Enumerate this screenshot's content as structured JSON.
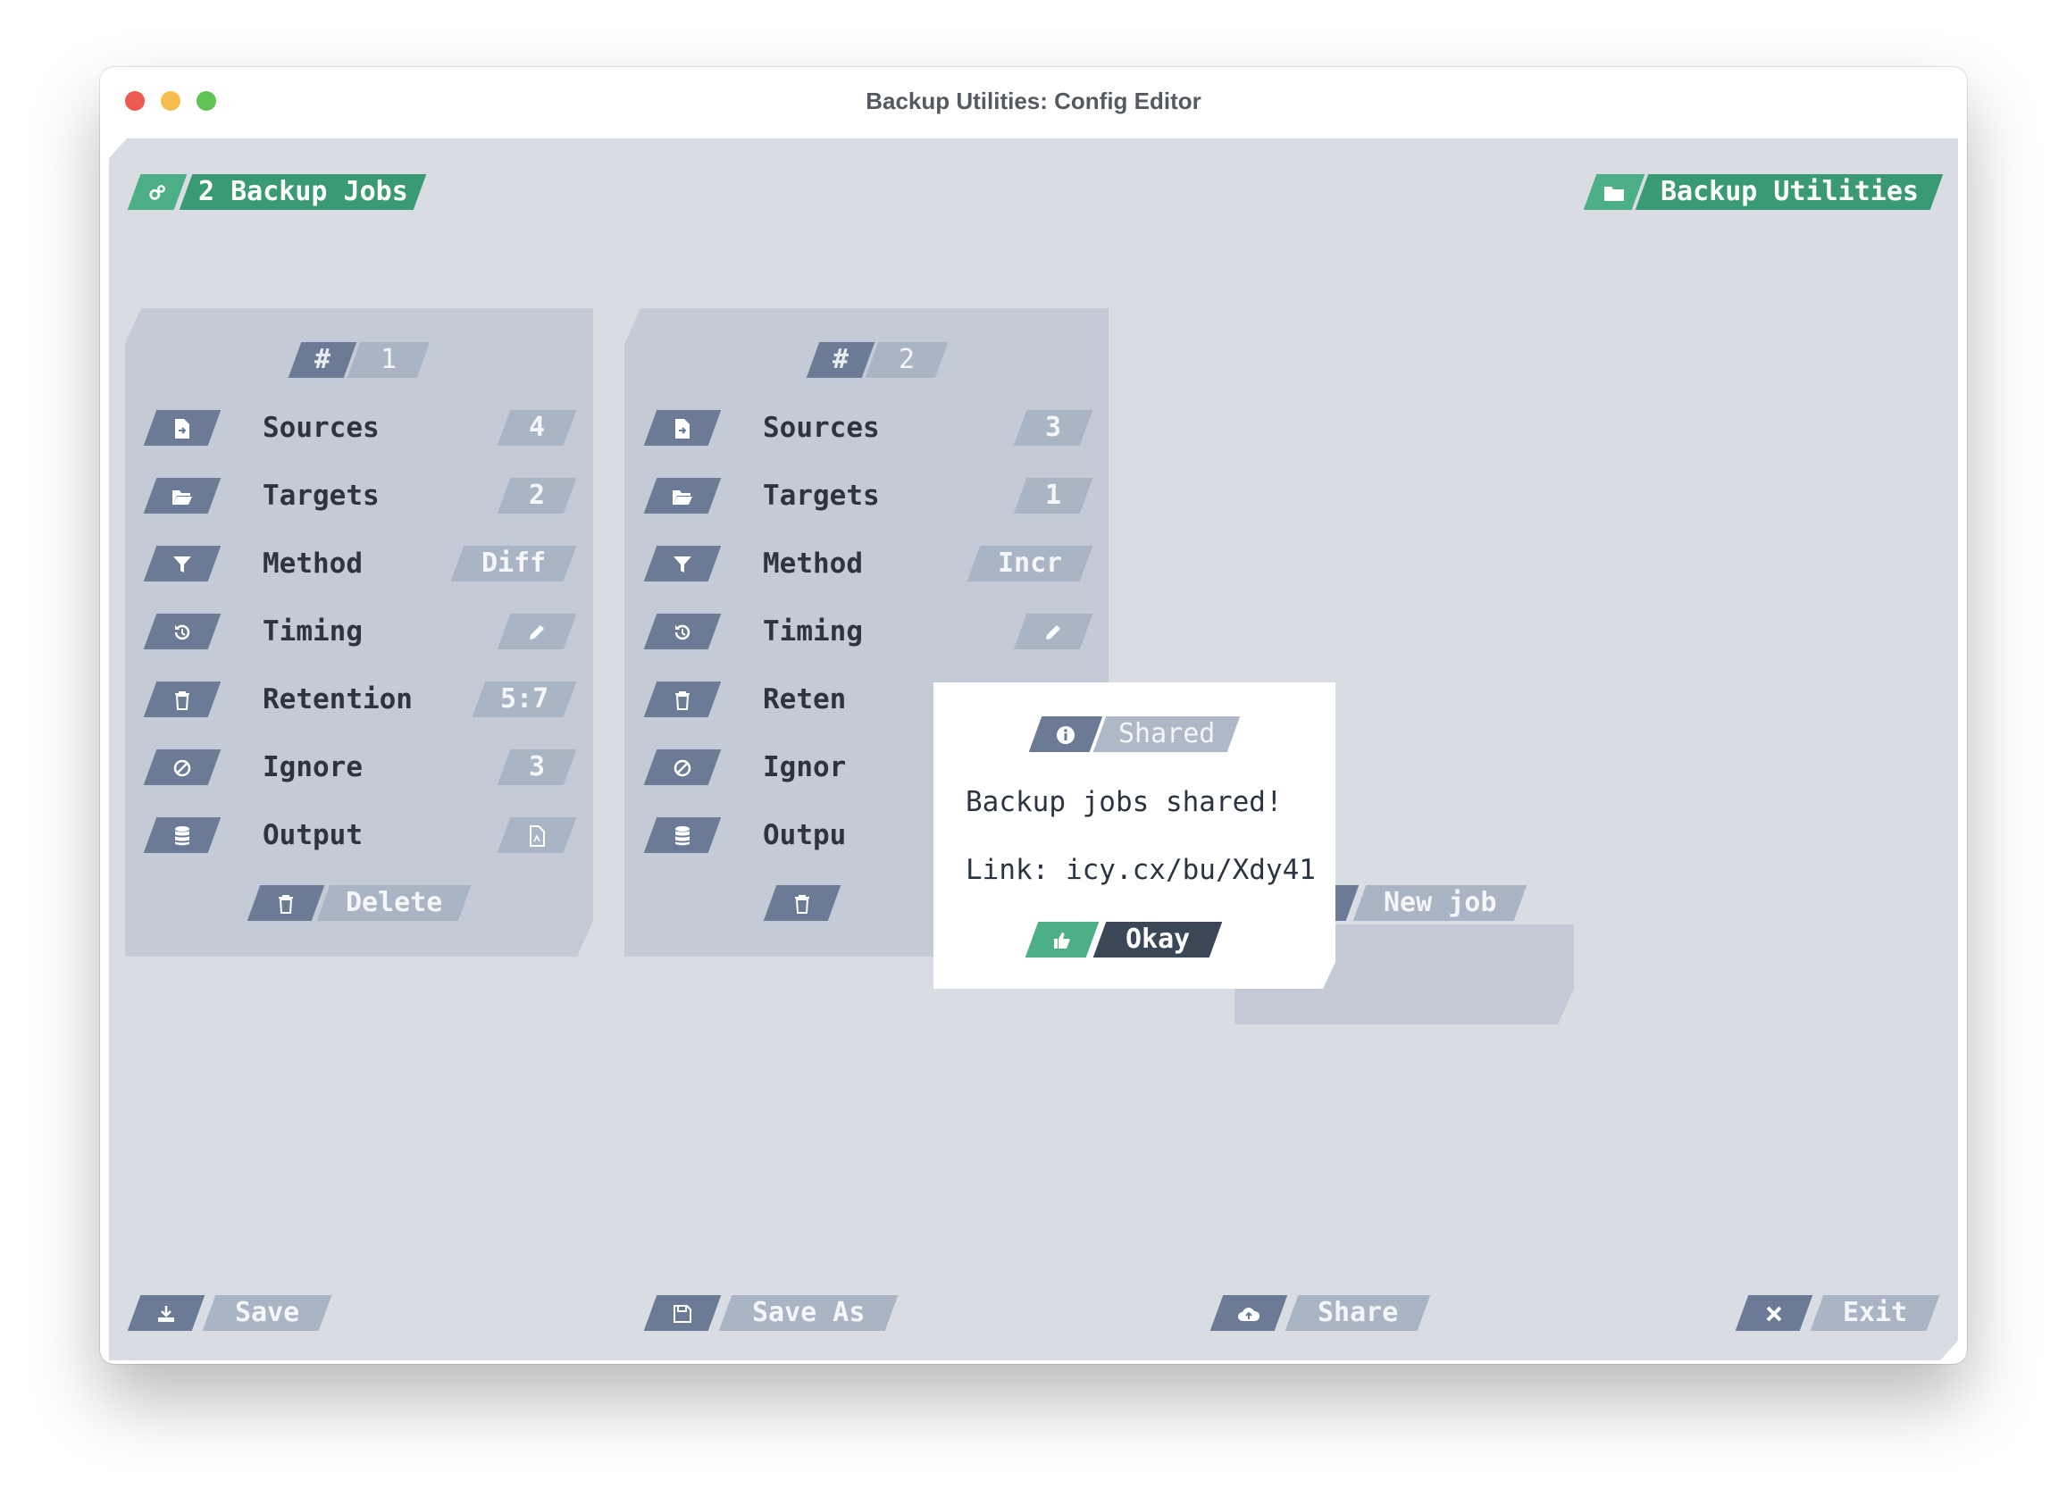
{
  "window": {
    "title": "Backup Utilities: Config Editor"
  },
  "header": {
    "jobs_count_label": "2 Backup Jobs",
    "app_label": "Backup Utilities"
  },
  "jobs": [
    {
      "number": "1",
      "rows": [
        {
          "label": "Sources",
          "value": "4",
          "icon": "file-import-icon"
        },
        {
          "label": "Targets",
          "value": "2",
          "icon": "folder-open-icon"
        },
        {
          "label": "Method",
          "value": "Diff",
          "icon": "filter-icon"
        },
        {
          "label": "Timing",
          "value": "",
          "icon": "history-icon",
          "value_icon": "pencil-icon"
        },
        {
          "label": "Retention",
          "value": "5:7",
          "icon": "trash-icon"
        },
        {
          "label": "Ignore",
          "value": "3",
          "icon": "ban-icon"
        },
        {
          "label": "Output",
          "value": "",
          "icon": "database-icon",
          "value_icon": "file-icon"
        }
      ],
      "delete_label": "Delete"
    },
    {
      "number": "2",
      "rows": [
        {
          "label": "Sources",
          "value": "3",
          "icon": "file-import-icon"
        },
        {
          "label": "Targets",
          "value": "1",
          "icon": "folder-open-icon"
        },
        {
          "label": "Method",
          "value": "Incr",
          "icon": "filter-icon"
        },
        {
          "label": "Timing",
          "value": "",
          "icon": "history-icon",
          "value_icon": "pencil-icon"
        },
        {
          "label": "Reten",
          "value": "",
          "icon": "trash-icon"
        },
        {
          "label": "Ignor",
          "value": "",
          "icon": "ban-icon"
        },
        {
          "label": "Outpu",
          "value": "",
          "icon": "database-icon"
        }
      ]
    }
  ],
  "new_job_label": "New job",
  "dialog": {
    "title": "Shared",
    "message": "Backup jobs shared!",
    "link_text": "Link: icy.cx/bu/Xdy41",
    "ok_label": "Okay"
  },
  "footer": {
    "save": "Save",
    "save_as": "Save As",
    "share": "Share",
    "exit": "Exit"
  },
  "colors": {
    "accent_green": "#4caf86",
    "slate": "#6b7b95",
    "dark": "#3b4756",
    "background": "#d9dde3"
  }
}
